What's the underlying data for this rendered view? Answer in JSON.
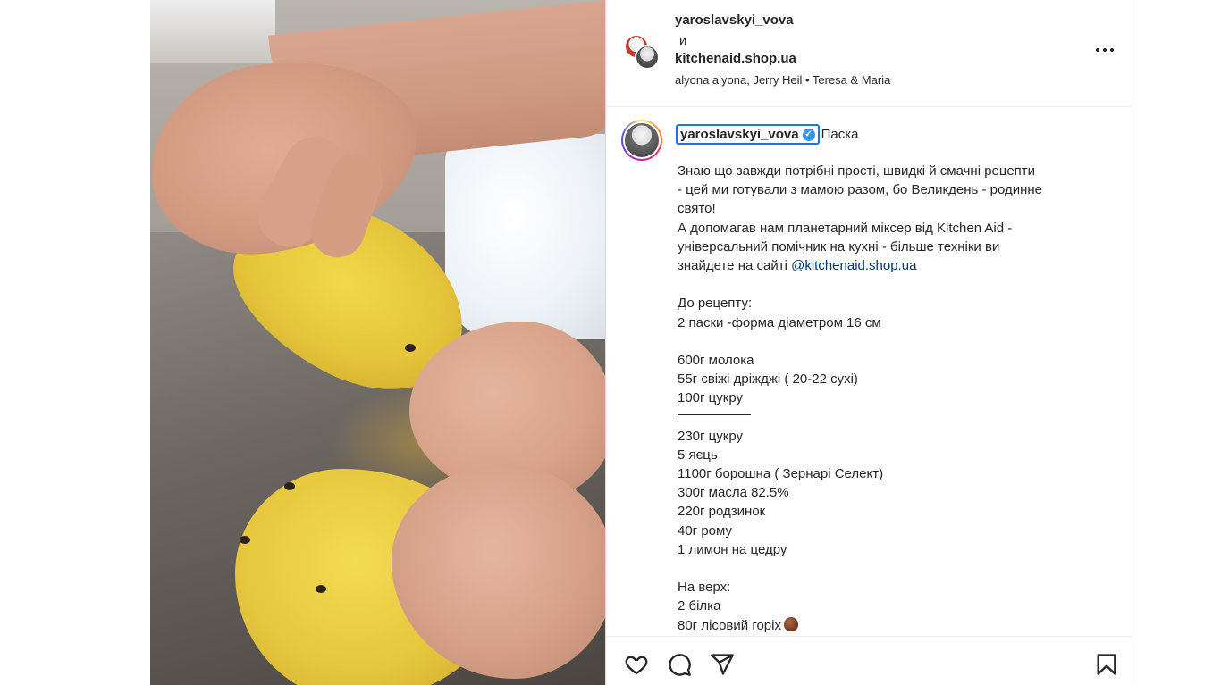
{
  "post_header": {
    "user1": "yaroslavskyi_vova",
    "conjunction": "и",
    "user2": "kitchenaid.shop.ua",
    "audio": "alyona alyona, Jerry Heil • Teresa & Maria"
  },
  "caption": {
    "username": "yaroslavskyi_vova",
    "verified_mark": "✓",
    "title": "Паска",
    "lines": [
      "Знаю що завжди потрібні прості, швидкі й смачні рецепти",
      "- цей ми готували з мамою разом, бо Великдень - родинне",
      "свято!",
      "А допомагав нам планетарний міксер від Kitchen Aid -",
      "універсальний помічник на кухні - більше техніки ви",
      "знайдете на сайті",
      "",
      "До рецепту:",
      "2 паски -форма діаметром 16 см",
      "",
      "600г молока",
      "55г свіжі дріжджі ( 20-22 сухі)",
      "100г цукру",
      "",
      "230г цукру",
      "5 яєць",
      "1100г борошна ( Зернарі Селект)",
      "300г масла 82.5%",
      "220г родзинок",
      "40г рому",
      "1 лимон на цедру",
      "",
      "На верх:",
      "2 білка",
      "80г лісовий горіх"
    ],
    "mention": "@kitchenaid.shop.ua"
  },
  "icons": {
    "more": "more-horizontal-icon",
    "like": "heart-icon",
    "comment": "comment-icon",
    "share": "share-icon",
    "save": "bookmark-icon",
    "verified": "verified-badge-icon",
    "emoji": "hazelnut-emoji"
  },
  "colors": {
    "text": "#262626",
    "mention": "#00376b",
    "verified": "#3897f0",
    "focus_ring": "#1a73e8",
    "border": "#dbdbdb"
  }
}
